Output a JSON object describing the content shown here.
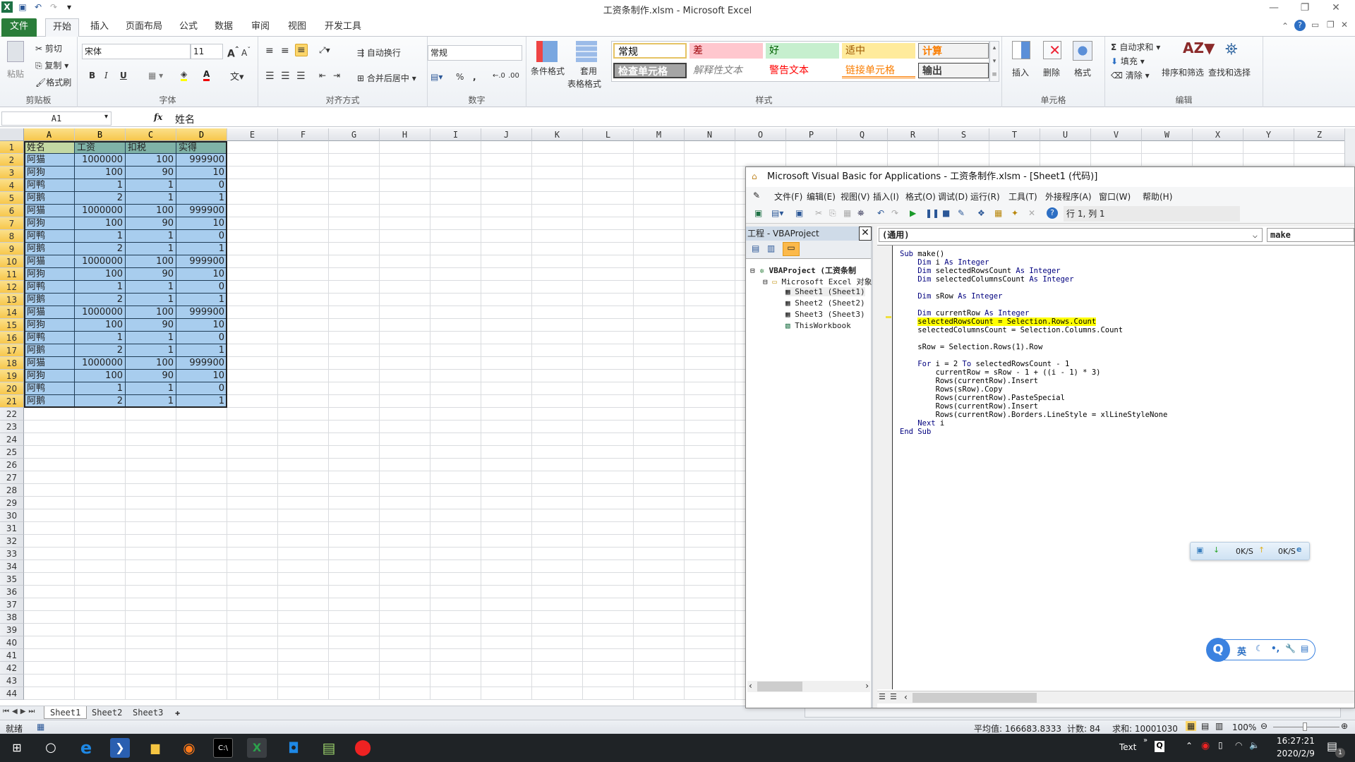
{
  "window": {
    "title": "工资条制作.xlsm - Microsoft Excel"
  },
  "ribbon": {
    "tabs": [
      "文件",
      "开始",
      "插入",
      "页面布局",
      "公式",
      "数据",
      "审阅",
      "视图",
      "开发工具"
    ],
    "active_tab": "开始",
    "clipboard": {
      "paste": "粘贴",
      "cut": "剪切",
      "copy": "复制",
      "format_painter": "格式刷",
      "label": "剪贴板"
    },
    "font": {
      "name": "宋体",
      "size": "11",
      "bold": "B",
      "italic": "I",
      "underline": "U",
      "label": "字体"
    },
    "alignment": {
      "wrap": "自动换行",
      "merge": "合并后居中",
      "label": "对齐方式"
    },
    "number": {
      "format": "常规",
      "percent": "%",
      "comma": ",",
      "label": "数字"
    },
    "styles": {
      "conditional": "条件格式",
      "table_format_1": "套用",
      "table_format_2": "表格格式",
      "cells": [
        {
          "text": "常规",
          "bg": "#ffffff",
          "fg": "#000000"
        },
        {
          "text": "差",
          "bg": "#ffc7ce",
          "fg": "#9c0006"
        },
        {
          "text": "好",
          "bg": "#c6efce",
          "fg": "#006100"
        },
        {
          "text": "适中",
          "bg": "#ffeb9c",
          "fg": "#9c5700"
        },
        {
          "text": "计算",
          "bg": "#f2f2f2",
          "fg": "#fa7d00"
        },
        {
          "text": "检查单元格",
          "bg": "#a5a5a5",
          "fg": "#ffffff"
        },
        {
          "text": "解释性文本",
          "bg": "transparent",
          "fg": "#7f7f7f"
        },
        {
          "text": "警告文本",
          "bg": "transparent",
          "fg": "#ff0000"
        },
        {
          "text": "链接单元格",
          "bg": "transparent",
          "fg": "#fa7d00"
        },
        {
          "text": "输出",
          "bg": "#f2f2f2",
          "fg": "#3f3f3f"
        }
      ],
      "label": "样式"
    },
    "cells_group": {
      "insert": "插入",
      "delete": "删除",
      "format": "格式",
      "label": "单元格"
    },
    "editing": {
      "autosum": "自动求和",
      "fill": "填充",
      "clear": "清除",
      "sort": "排序和筛选",
      "find": "查找和选择",
      "label": "编辑"
    }
  },
  "formula_bar": {
    "name_box": "A1",
    "fx": "fx",
    "value": "姓名"
  },
  "columns": [
    "A",
    "B",
    "C",
    "D",
    "E",
    "F",
    "G",
    "H",
    "I",
    "J",
    "K",
    "L",
    "M",
    "N",
    "O",
    "P",
    "Q",
    "R",
    "S",
    "T",
    "U",
    "V",
    "W",
    "X",
    "Y",
    "Z"
  ],
  "sheet": {
    "header": [
      "姓名",
      "工资",
      "扣税",
      "实得"
    ],
    "rows": [
      [
        "阿猫",
        "1000000",
        "100",
        "999900"
      ],
      [
        "阿狗",
        "100",
        "90",
        "10"
      ],
      [
        "阿鸭",
        "1",
        "1",
        "0"
      ],
      [
        "阿鹅",
        "2",
        "1",
        "1"
      ],
      [
        "阿猫",
        "1000000",
        "100",
        "999900"
      ],
      [
        "阿狗",
        "100",
        "90",
        "10"
      ],
      [
        "阿鸭",
        "1",
        "1",
        "0"
      ],
      [
        "阿鹅",
        "2",
        "1",
        "1"
      ],
      [
        "阿猫",
        "1000000",
        "100",
        "999900"
      ],
      [
        "阿狗",
        "100",
        "90",
        "10"
      ],
      [
        "阿鸭",
        "1",
        "1",
        "0"
      ],
      [
        "阿鹅",
        "2",
        "1",
        "1"
      ],
      [
        "阿猫",
        "1000000",
        "100",
        "999900"
      ],
      [
        "阿狗",
        "100",
        "90",
        "10"
      ],
      [
        "阿鸭",
        "1",
        "1",
        "0"
      ],
      [
        "阿鹅",
        "2",
        "1",
        "1"
      ],
      [
        "阿猫",
        "1000000",
        "100",
        "999900"
      ],
      [
        "阿狗",
        "100",
        "90",
        "10"
      ],
      [
        "阿鸭",
        "1",
        "1",
        "0"
      ],
      [
        "阿鹅",
        "2",
        "1",
        "1"
      ]
    ],
    "visible_row_count": 44
  },
  "sheet_tabs": [
    "Sheet1",
    "Sheet2",
    "Sheet3"
  ],
  "active_sheet": "Sheet1",
  "status": {
    "ready": "就绪",
    "average": "平均值: 166683.8333",
    "count": "计数: 84",
    "sum": "求和: 10001030",
    "zoom": "100%"
  },
  "vba": {
    "title": "Microsoft Visual Basic for Applications - 工资条制作.xlsm - [Sheet1 (代码)]",
    "menu": [
      "文件(F)",
      "编辑(E)",
      "视图(V)",
      "插入(I)",
      "格式(O)",
      "调试(D)",
      "运行(R)",
      "工具(T)",
      "外接程序(A)",
      "窗口(W)",
      "帮助(H)"
    ],
    "position": "行 1, 列 1",
    "project_title": "工程 - VBAProject",
    "tree": [
      "VBAProject (工资条制",
      "Microsoft Excel 对象",
      "Sheet1 (Sheet1)",
      "Sheet2 (Sheet2)",
      "Sheet3 (Sheet3)",
      "ThisWorkbook"
    ],
    "object_combo": "(通用)",
    "proc_combo": "make",
    "code": [
      "Sub make()",
      "    Dim i As Integer",
      "    Dim selectedRowsCount As Integer",
      "    Dim selectedColumnsCount As Integer",
      "",
      "    Dim sRow As Integer",
      "",
      "    Dim currentRow As Integer",
      "    selectedRowsCount = Selection.Rows.Count",
      "    selectedColumnsCount = Selection.Columns.Count",
      "",
      "    sRow = Selection.Rows(1).Row",
      "",
      "    For i = 2 To selectedRowsCount - 1",
      "        currentRow = sRow - 1 + ((i - 1) * 3)",
      "        Rows(currentRow).Insert",
      "        Rows(sRow).Copy",
      "        Rows(currentRow).PasteSpecial",
      "        Rows(currentRow).Insert",
      "        Rows(currentRow).Borders.LineStyle = xlLineStyleNone",
      "    Next i",
      "End Sub"
    ],
    "highlighted_line": 8
  },
  "netmon": {
    "down": "0K/S",
    "up": "0K/S"
  },
  "ime": {
    "lang": "英"
  },
  "taskbar": {
    "ime_text": "Text",
    "time": "16:27:21",
    "date": "2020/2/9",
    "notifications": "1"
  }
}
